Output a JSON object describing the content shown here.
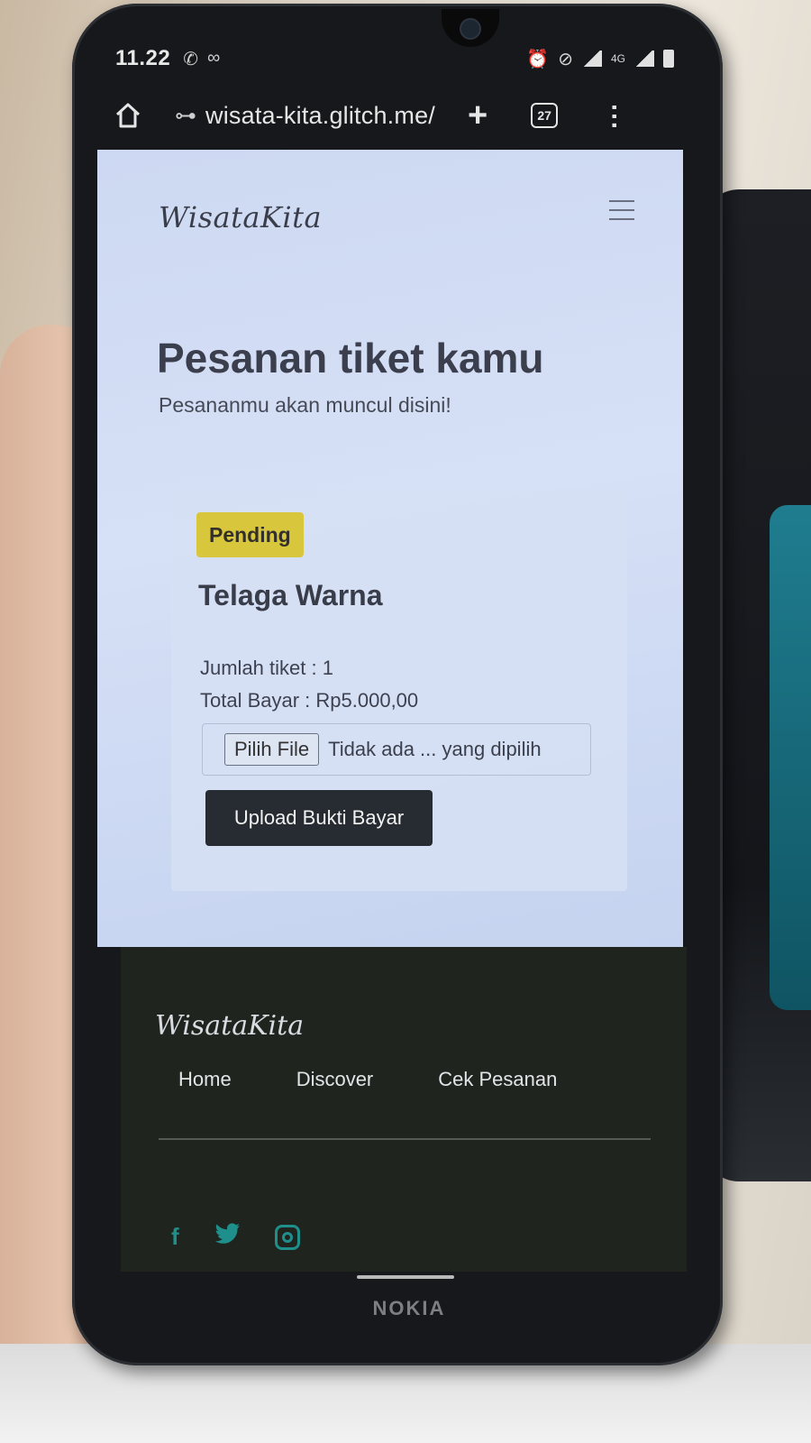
{
  "status_bar": {
    "time": "11.22",
    "network": "4G",
    "left_icons": [
      "whatsapp-icon",
      "incognito-icon"
    ],
    "right_icons": [
      "alarm-icon",
      "silent-icon",
      "signal-icon",
      "battery-icon"
    ]
  },
  "browser": {
    "url": "wisata-kita.glitch.me/",
    "tab_count": "27"
  },
  "header": {
    "brand": "WisataKita"
  },
  "main": {
    "title": "Pesanan tiket kamu",
    "subtitle": "Pesananmu akan muncul disini!"
  },
  "order": {
    "status": "Pending",
    "status_color": "#d8c63d",
    "destination": "Telaga Warna",
    "ticket_count_line": "Jumlah tiket : 1",
    "total_line": "Total Bayar : Rp5.000,00",
    "file_button": "Pilih File",
    "file_status": "Tidak ada ... yang dipilih",
    "upload_button": "Upload Bukti Bayar"
  },
  "footer": {
    "brand": "WisataKita",
    "nav": [
      "Home",
      "Discover",
      "Cek Pesanan"
    ],
    "social": [
      "facebook-icon",
      "twitter-icon",
      "instagram-icon"
    ],
    "accent": "#1f8f8b"
  },
  "device": {
    "maker": "NOKIA"
  }
}
